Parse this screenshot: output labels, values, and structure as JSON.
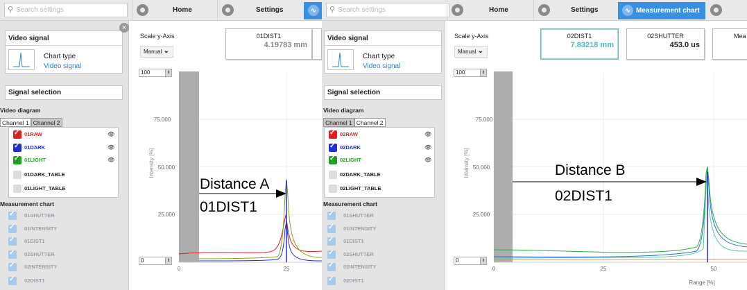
{
  "colors": {
    "accent_blue": "#3b8fe0",
    "raw_red": "#e02020",
    "dark_blue": "#2030d0",
    "light_green": "#20a020",
    "teal": "#4bb7bc"
  },
  "panel_left": {
    "search": {
      "placeholder": "Search settings"
    },
    "nav": {
      "home": "Home",
      "settings": "Settings"
    },
    "video_signal": {
      "title": "Video signal",
      "chart_type_label": "Chart type",
      "chart_type_value": "Video signal"
    },
    "signal_selection": {
      "title": "Signal selection"
    },
    "video_diagram": {
      "label": "Video diagram",
      "tabs": [
        "Channel 1",
        "Channel 2"
      ],
      "signals": [
        {
          "label": "01RAW",
          "checked": true,
          "color": "#e02020"
        },
        {
          "label": "01DARK",
          "checked": true,
          "color": "#2030d0"
        },
        {
          "label": "01LIGHT",
          "checked": true,
          "color": "#20a020"
        },
        {
          "label": "01DARK_TABLE",
          "checked": false
        },
        {
          "label": "01LIGHT_TABLE",
          "checked": false
        }
      ]
    },
    "measurement_chart": {
      "label": "Measurement chart",
      "items": [
        "01SHUTTER",
        "01INTENSITY",
        "01DIST1",
        "02SHUTTER",
        "02INTENSITY",
        "02DIST1"
      ]
    },
    "scale": {
      "label": "Scale y-Axis",
      "mode": "Manual",
      "max": "100",
      "min": "0"
    },
    "measurements": [
      {
        "name": "01DIST1",
        "value": "4.19783 mm"
      }
    ],
    "chart": {
      "y_axis_label": "Intensity [%]",
      "y_ticks": [
        "75.000",
        "50.000",
        "25.000"
      ],
      "x_ticks": [
        "0",
        "25"
      ],
      "annotation_title": "Distance A",
      "annotation_value": "01DIST1"
    }
  },
  "panel_right": {
    "search": {
      "placeholder": "Search settings"
    },
    "nav": {
      "home": "Home",
      "settings": "Settings",
      "measurement_chart": "Measurement chart"
    },
    "video_signal": {
      "title": "Video signal",
      "chart_type_label": "Chart type",
      "chart_type_value": "Video signal"
    },
    "signal_selection": {
      "title": "Signal selection"
    },
    "video_diagram": {
      "label": "Video diagram",
      "tabs": [
        "Channel 1",
        "Channel 2"
      ],
      "signals": [
        {
          "label": "02RAW",
          "checked": true,
          "color": "#e02020"
        },
        {
          "label": "02DARK",
          "checked": true,
          "color": "#2030d0"
        },
        {
          "label": "02LIGHT",
          "checked": true,
          "color": "#20a020"
        },
        {
          "label": "02DARK_TABLE",
          "checked": false
        },
        {
          "label": "02LIGHT_TABLE",
          "checked": false
        }
      ]
    },
    "measurement_chart": {
      "label": "Measurement chart",
      "items": [
        "01SHUTTER",
        "01INTENSITY",
        "01DIST1",
        "02SHUTTER",
        "02INTENSITY",
        "02DIST1"
      ]
    },
    "scale": {
      "label": "Scale y-Axis",
      "mode": "Manual",
      "max": "100",
      "min": "0"
    },
    "measurements": [
      {
        "name": "02DIST1",
        "value": "7.83218 mm"
      },
      {
        "name": "02SHUTTER",
        "value": "453.0 us"
      },
      {
        "name": "Mea",
        "value": ""
      }
    ],
    "chart": {
      "y_axis_label": "Intensity [%]",
      "y_ticks": [
        "75.000",
        "50.000",
        "25.000"
      ],
      "x_ticks": [
        "0",
        "25",
        "50"
      ],
      "x_axis_label": "Range [%]",
      "annotation_title": "Distance B",
      "annotation_value": "02DIST1"
    }
  }
}
